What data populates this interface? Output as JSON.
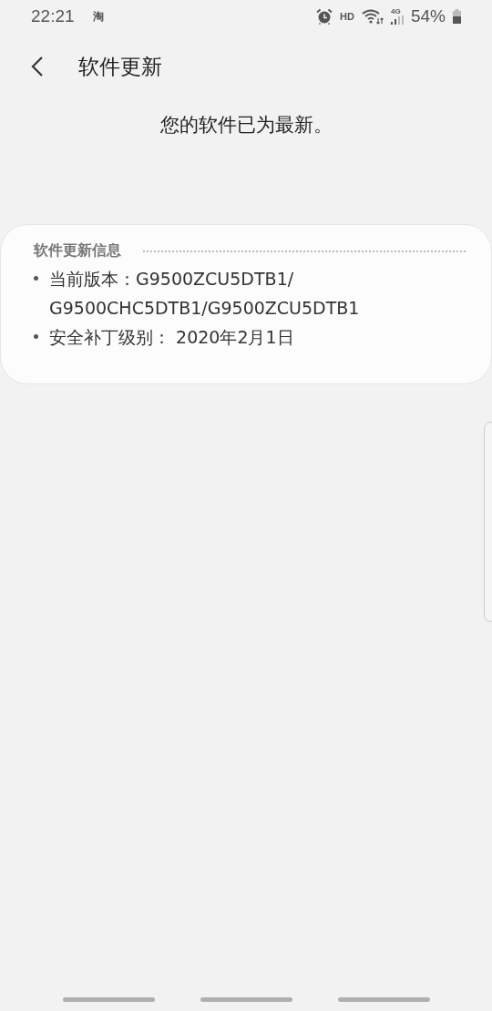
{
  "status_bar": {
    "time": "22:21",
    "notification": "淘",
    "hd": "HD",
    "network": "4G",
    "battery": "54%"
  },
  "header": {
    "title": "软件更新"
  },
  "message": "您的软件已为最新。",
  "info_card": {
    "title": "软件更新信息",
    "items": [
      {
        "label": "当前版本：",
        "value": "G9500ZCU5DTB1/ G9500CHC5DTB1/G9500ZCU5DTB1"
      },
      {
        "label": "安全补丁级别：",
        "value": " 2020年2月1日"
      }
    ]
  }
}
